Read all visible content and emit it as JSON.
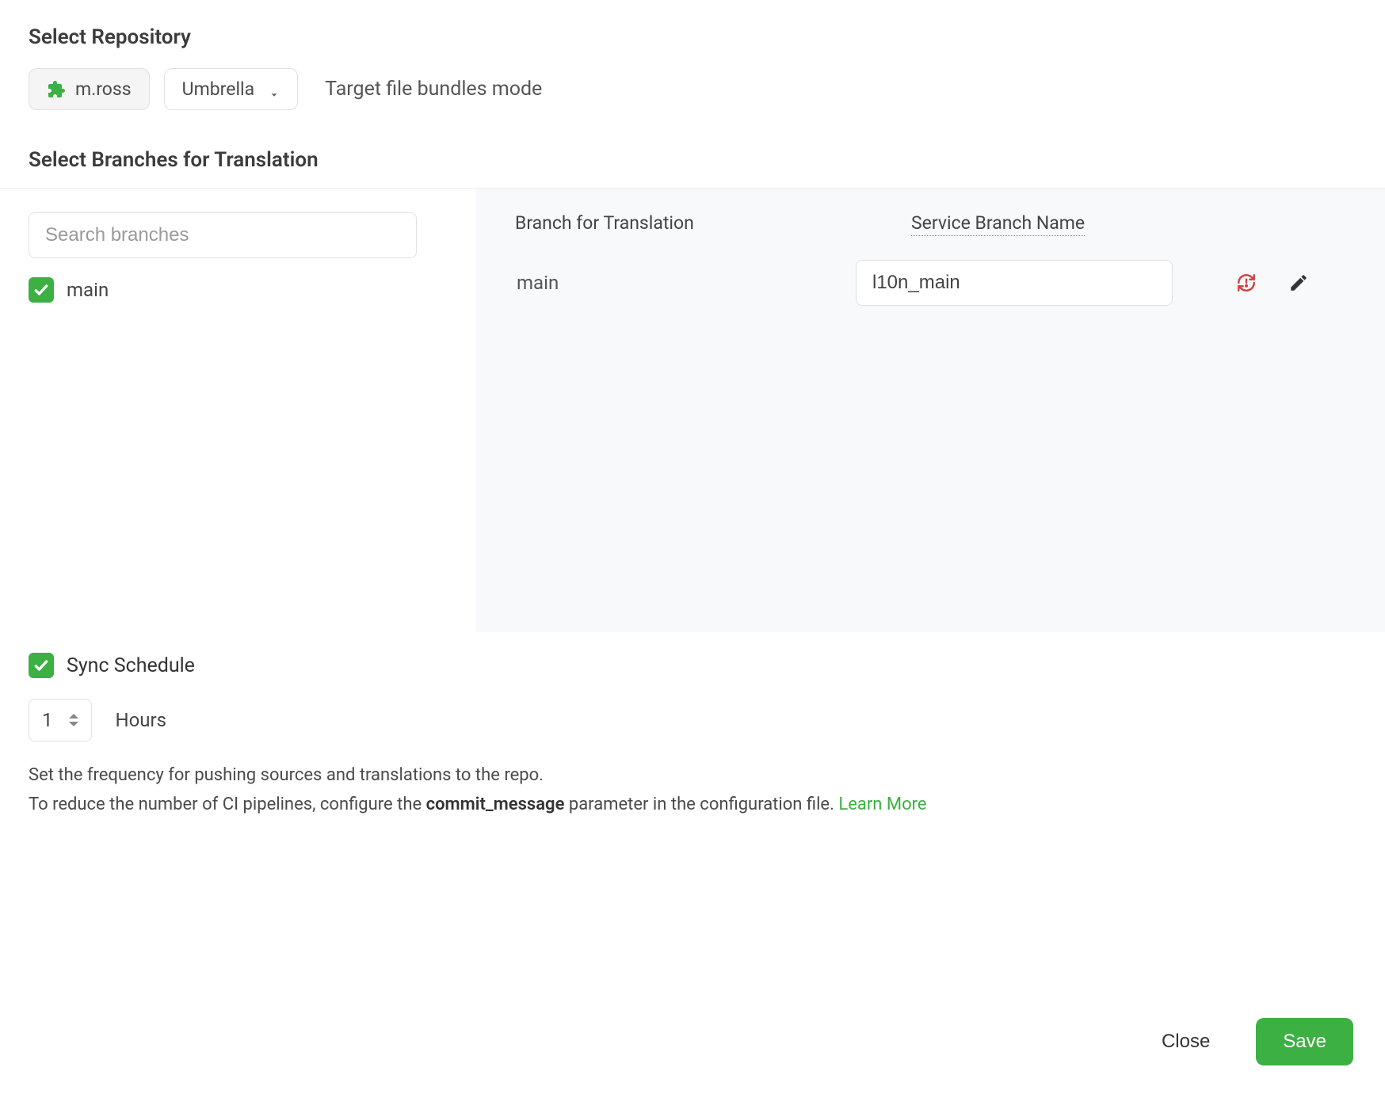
{
  "repo_section": {
    "heading": "Select Repository",
    "owner_label": "m.ross",
    "project_label": "Umbrella",
    "target_mode": "Target file bundles mode"
  },
  "branches_section": {
    "heading": "Select Branches for Translation",
    "search_placeholder": "Search branches",
    "items": [
      {
        "name": "main",
        "checked": true
      }
    ],
    "columns": {
      "branch": "Branch for Translation",
      "service": "Service Branch Name"
    },
    "rows": [
      {
        "branch_name": "main",
        "service_branch": "l10n_main"
      }
    ]
  },
  "sync_section": {
    "label": "Sync Schedule",
    "checked": true,
    "value": "1",
    "unit": "Hours",
    "help_line1": "Set the frequency for pushing sources and translations to the repo.",
    "help_line2_prefix": "To reduce the number of CI pipelines, configure the ",
    "help_line2_param": "commit_message",
    "help_line2_suffix": " parameter in the configuration file. ",
    "learn_more": "Learn More"
  },
  "footer": {
    "close": "Close",
    "save": "Save"
  }
}
